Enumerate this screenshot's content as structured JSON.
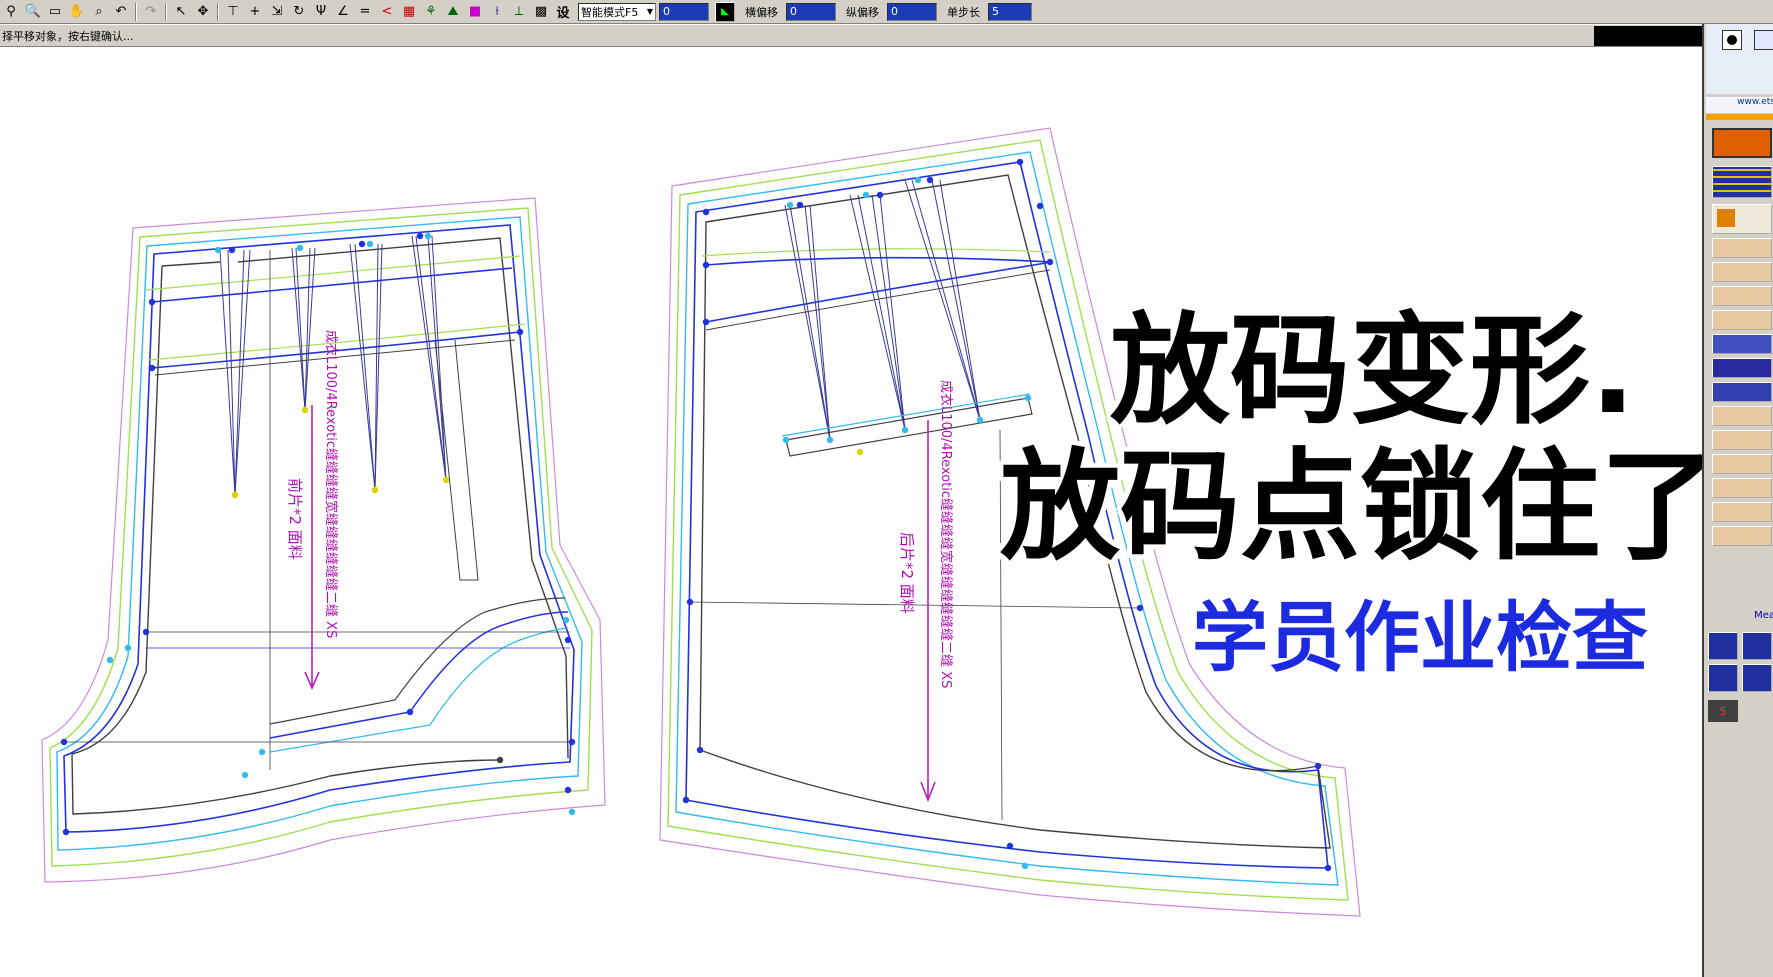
{
  "toolbar": {
    "mode_select": "智能模式F5",
    "offset_x_value": "0",
    "offset_x_label": "横偏移",
    "offset_x_input": "0",
    "offset_y_label": "纵偏移",
    "offset_y_input": "0",
    "step_label": "单步长",
    "step_input": "5",
    "settings_label": "设"
  },
  "status": {
    "prompt": "择平移对象，按右键确认..."
  },
  "right_panel": {
    "url": "www.ets",
    "measure_label": "Mea",
    "size_value": "5"
  },
  "pattern": {
    "front_label": "前片*2   面料",
    "back_label": "后片*2   面料",
    "front_size_text": "成衣L100/4Rexotic缝缝缝缝宽缝缝缝缝缝缝二缝 XS",
    "back_size_text": "成衣L100/4Rexotic缝缝缝缝宽缝缝缝缝缝缝二缝 XS"
  },
  "overlay": {
    "line1": "放码变形.",
    "line2": "放码点锁住了",
    "line3": "学员作业检查"
  },
  "colors": {
    "base_line": "#404040",
    "size_blue": "#2233dd",
    "size_cyan": "#33bbee",
    "size_green": "#9fe050",
    "size_violet": "#cc88dd",
    "grain_magenta": "#c020c0",
    "caption_blue": "#1d2be0",
    "toolbar_bg": "#d4d0c8"
  }
}
